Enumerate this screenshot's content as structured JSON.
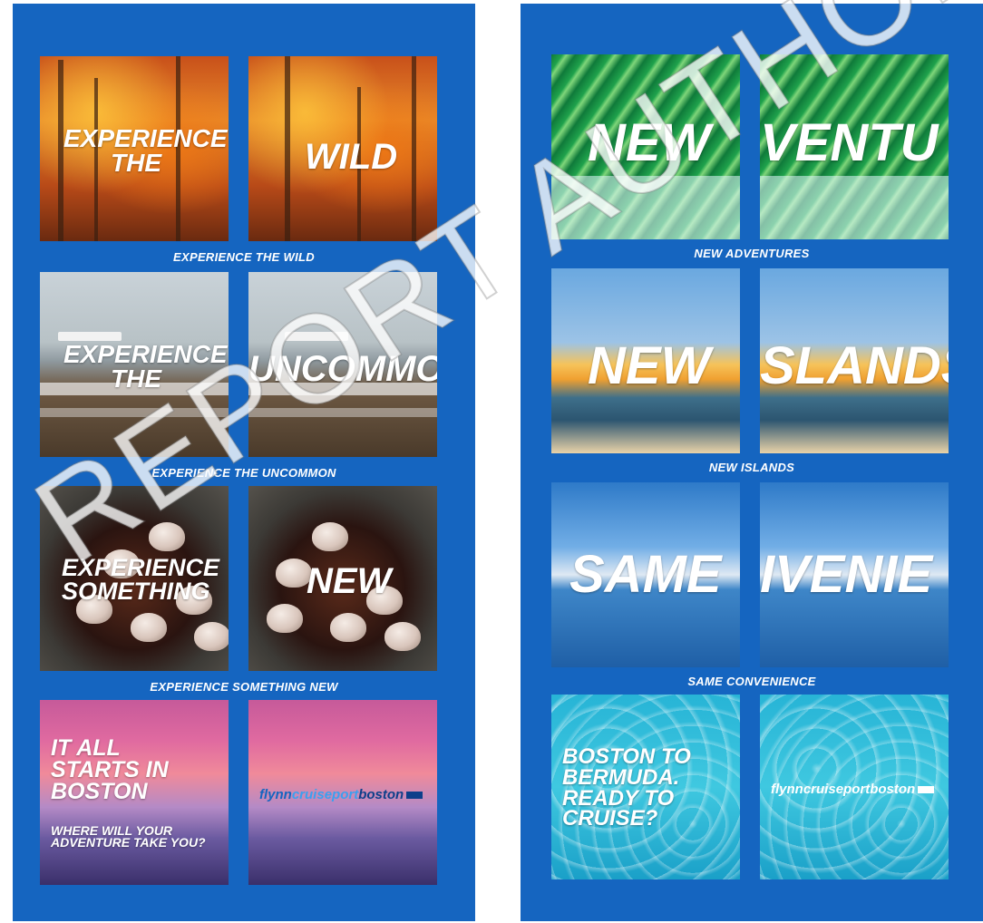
{
  "left_panel": {
    "rows": [
      {
        "tile_a_text": "EXPERIENCE\nTHE",
        "tile_b_text": "WILD",
        "caption": "EXPERIENCE THE WILD"
      },
      {
        "tile_a_text": "EXPERIENCE\nTHE",
        "tile_b_text": "UNCOMMON",
        "caption": "EXPERIENCE THE UNCOMMON"
      },
      {
        "tile_a_text": "EXPERIENCE\nSOMETHING",
        "tile_b_text": "NEW",
        "caption": "EXPERIENCE SOMETHING NEW"
      },
      {
        "tile_a_text": "IT ALL\nSTARTS IN\nBOSTON",
        "tile_a_sub": "WHERE WILL YOUR\nADVENTURE TAKE YOU?"
      }
    ],
    "logo": {
      "part1": "flynn",
      "part2": "cruiseport",
      "part3": "boston"
    }
  },
  "right_panel": {
    "rows": [
      {
        "tile_a_text": "NEW",
        "tile_b_text": "VENTU",
        "caption": "NEW ADVENTURES"
      },
      {
        "tile_a_text": "NEW",
        "tile_b_text": "SLANDS",
        "caption": "NEW ISLANDS"
      },
      {
        "tile_a_text": "SAME",
        "tile_b_text": "IVENIE",
        "caption": "SAME CONVENIENCE"
      },
      {
        "tile_a_text": "BOSTON TO\nBERMUDA.\nREADY TO\nCRUISE?"
      }
    ],
    "logo": {
      "part1": "flynn",
      "part2": "cruiseport",
      "part3": "boston"
    }
  },
  "watermark": "REPORT AUTHORITY",
  "colors": {
    "panel_blue": "#1565c0",
    "text_white": "#ffffff",
    "logo_dark": "#0d3f8a",
    "logo_light": "#3aa0f0"
  }
}
